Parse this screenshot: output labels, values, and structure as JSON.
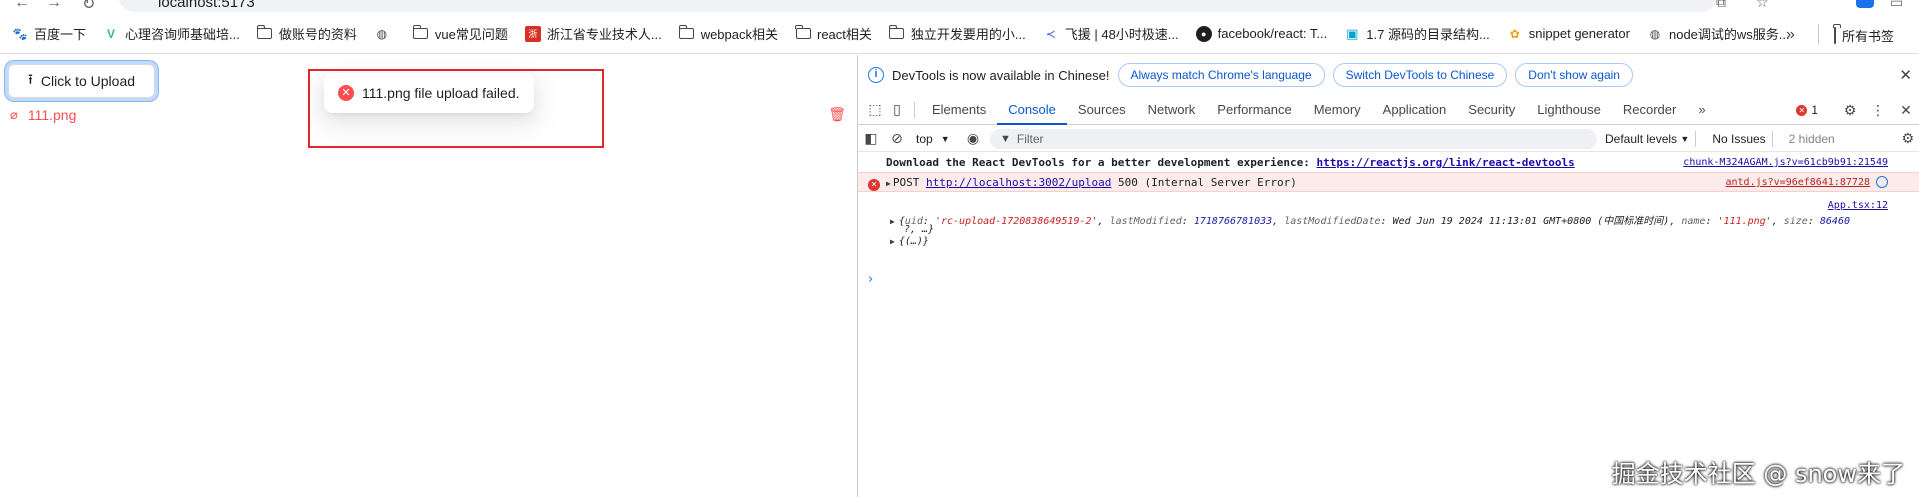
{
  "browser": {
    "address": "localhost:5173",
    "bookmarks": [
      {
        "icon": "baidu-icon",
        "label": "百度一下"
      },
      {
        "icon": "vue-icon",
        "label": "心理咨询师基础培..."
      },
      {
        "icon": "folder-icon",
        "label": "做账号的资料"
      },
      {
        "icon": "globe-icon",
        "label": ""
      },
      {
        "icon": "folder-icon",
        "label": "vue常见问题"
      },
      {
        "icon": "red-logo-icon",
        "label": "浙江省专业技术人..."
      },
      {
        "icon": "folder-icon",
        "label": "webpack相关"
      },
      {
        "icon": "folder-icon",
        "label": "react相关"
      },
      {
        "icon": "folder-icon",
        "label": "独立开发要用的小..."
      },
      {
        "icon": "feiyuan-icon",
        "label": "飞援 | 48小时极速..."
      },
      {
        "icon": "github-icon",
        "label": "facebook/react: T..."
      },
      {
        "icon": "bilibili-icon",
        "label": "1.7 源码的目录结构..."
      },
      {
        "icon": "snippet-icon",
        "label": "snippet generator"
      },
      {
        "icon": "globe-icon",
        "label": "node调试的ws服务..."
      }
    ],
    "more": "»",
    "all_bookmarks": "所有书签"
  },
  "page": {
    "upload_button": "Click to Upload",
    "file_name": "111.png",
    "toast_message": "111.png file upload failed."
  },
  "devtools": {
    "info_text": "DevTools is now available in Chinese!",
    "info_buttons": [
      "Always match Chrome's language",
      "Switch DevTools to Chinese",
      "Don't show again"
    ],
    "tabs": [
      "Elements",
      "Console",
      "Sources",
      "Network",
      "Performance",
      "Memory",
      "Application",
      "Security",
      "Lighthouse",
      "Recorder"
    ],
    "tabs_more": "»",
    "active_tab": "Console",
    "error_count": "1",
    "context": "top",
    "filter_placeholder": "Filter",
    "levels": "Default levels",
    "issues": "No Issues",
    "hidden": "2 hidden",
    "messages": {
      "devtools_hint": "Download the React DevTools for a better development experience: ",
      "devtools_link": "https://reactjs.org/link/react-devtools",
      "devtools_src": "chunk-M324AGAM.js?v=61cb9b91:21549",
      "error_method": "POST",
      "error_url": "http://localhost:3002/upload",
      "error_status": "500 (Internal Server Error)",
      "error_src": "antd.js?v=96ef8641:87728",
      "log_src": "App.tsx:12",
      "log_uid_key": "uid",
      "log_uid_val": "'rc-upload-1720838649519-2'",
      "log_lm_key": "lastModified",
      "log_lm_val": "1718766781033",
      "log_lmd_key": "lastModifiedDate",
      "log_lmd_val": "Wed Jun 19 2024 11:13:01 GMT+0800 (中国标准时间)",
      "log_name_key": "name",
      "log_name_val": "'111.png'",
      "log_size_key": "size",
      "log_size_val": "86460",
      "log_cont": "?, …}",
      "log_obj": "{(…)}"
    },
    "prompt": "›"
  },
  "watermark": "掘金技术社区 @ snow来了"
}
